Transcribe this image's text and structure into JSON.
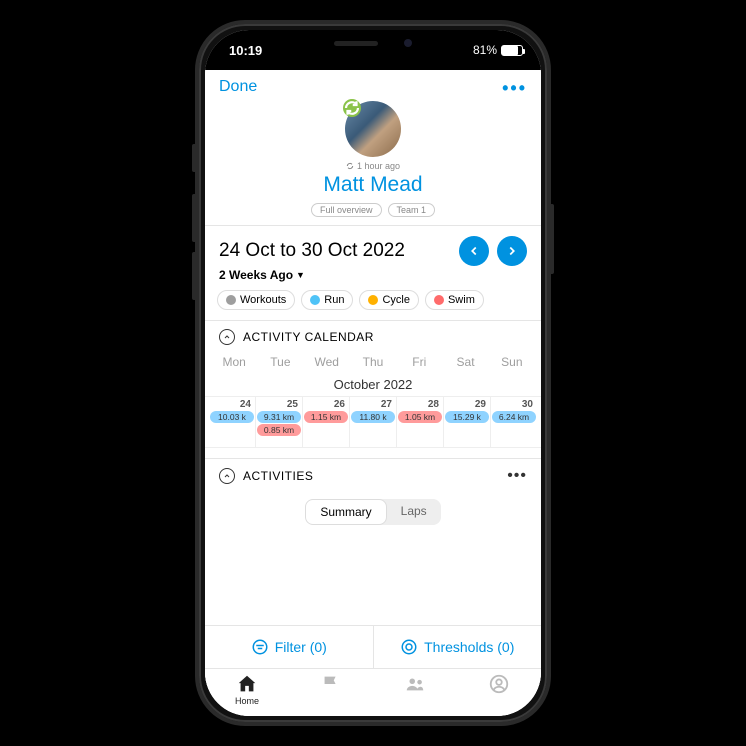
{
  "status": {
    "time": "10:19",
    "battery_pct": "81%",
    "battery_fill": 81
  },
  "header": {
    "done": "Done"
  },
  "profile": {
    "last_sync": "1 hour ago",
    "name": "Matt Mead",
    "pills": [
      "Full overview",
      "Team 1"
    ]
  },
  "daterange": {
    "label": "24 Oct to 30 Oct 2022",
    "ago": "2 Weeks Ago"
  },
  "chips": {
    "workouts": "Workouts",
    "run": "Run",
    "cycle": "Cycle",
    "swim": "Swim"
  },
  "calendar": {
    "title": "ACTIVITY CALENDAR",
    "weekdays": [
      "Mon",
      "Tue",
      "Wed",
      "Thu",
      "Fri",
      "Sat",
      "Sun"
    ],
    "month": "October 2022",
    "days": [
      {
        "date": "24",
        "acts": [
          {
            "label": "10.03 k",
            "type": "blue"
          }
        ]
      },
      {
        "date": "25",
        "acts": [
          {
            "label": "9.31 km",
            "type": "blue"
          },
          {
            "label": "0.85 km",
            "type": "red"
          }
        ]
      },
      {
        "date": "26",
        "acts": [
          {
            "label": "1.15 km",
            "type": "red"
          }
        ]
      },
      {
        "date": "27",
        "acts": [
          {
            "label": "11.80 k",
            "type": "blue"
          }
        ]
      },
      {
        "date": "28",
        "acts": [
          {
            "label": "1.05 km",
            "type": "red"
          }
        ]
      },
      {
        "date": "29",
        "acts": [
          {
            "label": "15.29 k",
            "type": "blue"
          }
        ]
      },
      {
        "date": "30",
        "acts": [
          {
            "label": "6.24 km",
            "type": "blue"
          }
        ]
      }
    ]
  },
  "activities": {
    "title": "ACTIVITIES",
    "tabs": {
      "summary": "Summary",
      "laps": "Laps"
    }
  },
  "filters": {
    "filter": "Filter (0)",
    "thresholds": "Thresholds (0)"
  },
  "tabbar": {
    "home": "Home"
  }
}
